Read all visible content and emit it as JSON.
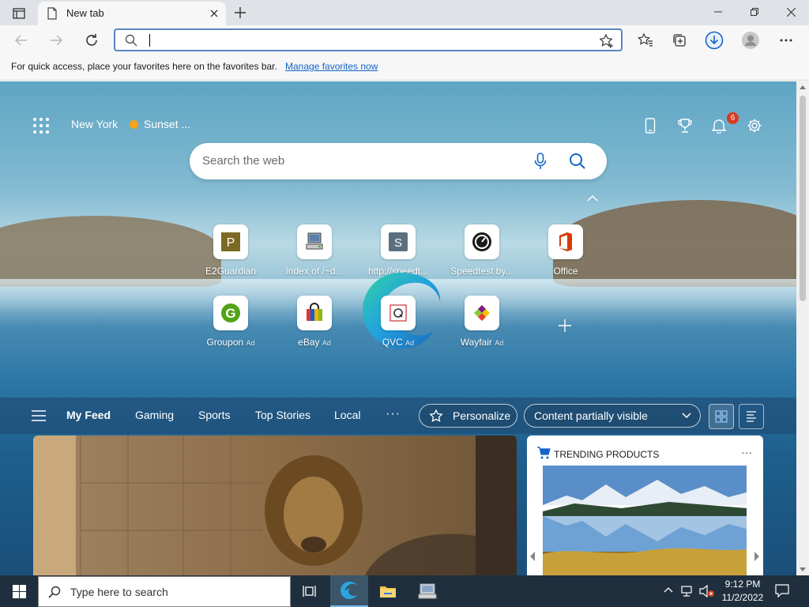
{
  "browser": {
    "tab_title": "New tab",
    "address_value": ""
  },
  "favorites_bar": {
    "message": "For quick access, place your favorites here on the favorites bar.",
    "link": "Manage favorites now"
  },
  "newtab": {
    "location": "New York",
    "weather": "Sunset ...",
    "notification_count": "6",
    "search_placeholder": "Search the web",
    "tiles_row1": [
      {
        "label": "E2Guardian",
        "icon": "e2guardian-icon"
      },
      {
        "label": "Index of /~d...",
        "icon": "computer-icon"
      },
      {
        "label": "http://speedt...",
        "icon": "s-letter-icon"
      },
      {
        "label": "Speedtest by...",
        "icon": "speedtest-gauge-icon"
      },
      {
        "label": "Office",
        "icon": "office-icon"
      }
    ],
    "tiles_row2": [
      {
        "label": "Groupon",
        "ad": "Ad",
        "icon": "groupon-icon"
      },
      {
        "label": "eBay",
        "ad": "Ad",
        "icon": "ebay-bag-icon"
      },
      {
        "label": "QVC",
        "ad": "Ad",
        "icon": "qvc-icon"
      },
      {
        "label": "Wayfair",
        "ad": "Ad",
        "icon": "wayfair-icon"
      }
    ]
  },
  "feed": {
    "tabs": [
      "My Feed",
      "Gaming",
      "Sports",
      "Top Stories",
      "Local"
    ],
    "more": "···",
    "personalize": "Personalize",
    "content_visibility": "Content partially visible",
    "trending_title": "TRENDING PRODUCTS",
    "trending_more": "···"
  },
  "taskbar": {
    "search_placeholder": "Type here to search",
    "time": "9:12 PM",
    "date": "11/2/2022"
  },
  "colors": {
    "accent": "#1464c8",
    "address_border": "#5a84c4",
    "badge": "#d83b1f",
    "taskbar": "#1f2f3d"
  }
}
